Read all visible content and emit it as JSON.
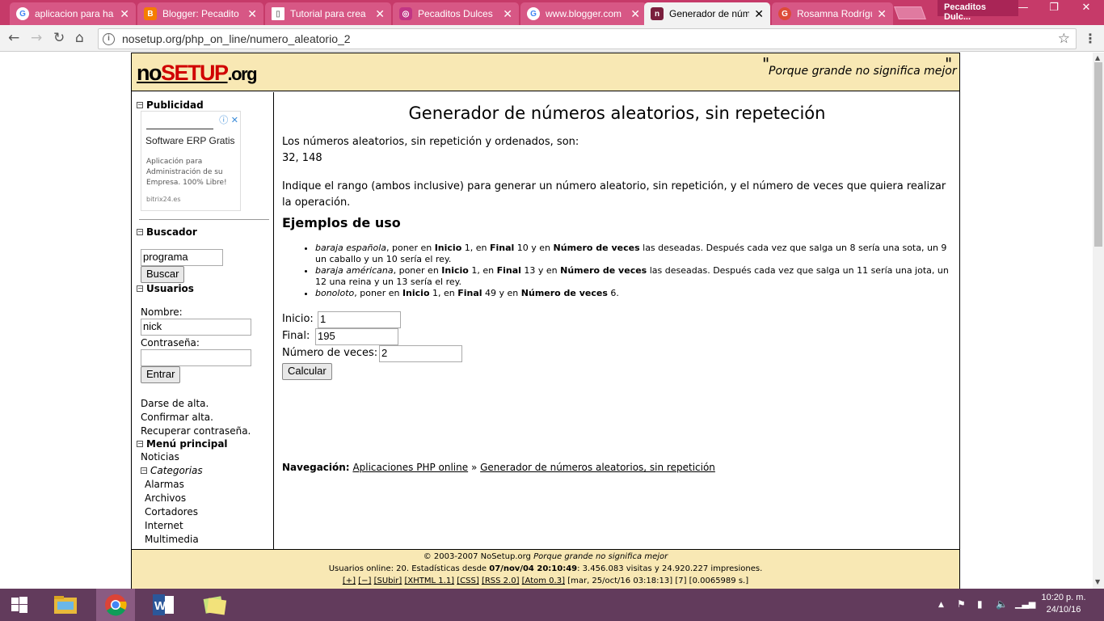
{
  "browser": {
    "tabs": [
      {
        "title": "aplicacion para ha",
        "icon": "google-icon"
      },
      {
        "title": "Blogger: Pecadito",
        "icon": "blogger-icon"
      },
      {
        "title": "Tutorial para crea",
        "icon": "page-icon"
      },
      {
        "title": "Pecaditos Dulces",
        "icon": "instagram-icon"
      },
      {
        "title": "www.blogger.com",
        "icon": "google-icon"
      },
      {
        "title": "Generador de núm",
        "icon": "nosetup-icon",
        "active": true
      },
      {
        "title": "Rosamna Rodrígu",
        "icon": "google-plus-icon"
      }
    ],
    "profile": "Pecaditos Dulc...",
    "url": "nosetup.org/php_on_line/numero_aleatorio_2",
    "accent": "#c63a69"
  },
  "header": {
    "logo_no": "no",
    "logo_setup": "SETUP",
    "logo_org": ".org",
    "slogan": "Porque grande no significa mejor"
  },
  "sidebar": {
    "publicidad": "Publicidad",
    "ad": {
      "title": "Software ERP Gratis",
      "desc": "Aplicación para Administración de su Empresa. 100% Libre!",
      "url": "bitrix24.es"
    },
    "buscador": "Buscador",
    "search_value": "programa",
    "search_button": "Buscar",
    "usuarios": "Usuarios",
    "nombre_label": "Nombre:",
    "nombre_value": "nick",
    "pass_label": "Contraseña:",
    "login_button": "Entrar",
    "links": [
      "Darse de alta.",
      "Confirmar alta.",
      "Recuperar contraseña."
    ],
    "menu_principal": "Menú principal",
    "noticias": "Noticias",
    "categorias": "Categorias",
    "categories": [
      "Alarmas",
      "Archivos",
      "Cortadores",
      "Internet",
      "Multimedia"
    ]
  },
  "content": {
    "title": "Generador de números aleatorios, sin repeteción",
    "result_label": "Los números aleatorios, sin repetición y ordenados, son:",
    "result_value": "32, 148",
    "instructions": "Indique el rango (ambos inclusive) para generar un número aleatorio, sin repetición, y el número de veces que quiera realizar la operación.",
    "examples_heading": "Ejemplos de uso",
    "examples": [
      {
        "em": "baraja española",
        "rest1": ", poner en ",
        "b1": "Inicio",
        "rest2": " 1, en ",
        "b2": "Final",
        "rest3": " 10 y en ",
        "b3": "Número de veces",
        "rest4": " las deseadas. Después cada vez que salga un 8 sería una sota, un 9 un caballo y un 10 sería el rey."
      },
      {
        "em": "baraja américana",
        "rest1": ", poner en ",
        "b1": "Inicio",
        "rest2": " 1, en ",
        "b2": "Final",
        "rest3": " 13 y en ",
        "b3": "Número de veces",
        "rest4": " las deseadas. Después cada vez que salga un 11 sería una jota, un 12 una reina y un 13 sería el rey."
      },
      {
        "em": "bonoloto",
        "rest1": ", poner en ",
        "b1": "Inicio",
        "rest2": " 1, en ",
        "b2": "Final",
        "rest3": " 49 y en ",
        "b3": "Número de veces",
        "rest4": " 6."
      }
    ],
    "inicio_label": "Inicio:",
    "inicio_value": "1",
    "final_label": "Final:",
    "final_value": "195",
    "veces_label": "Número de veces:",
    "veces_value": "2",
    "calc_button": "Calcular",
    "nav_label": "Navegación:",
    "nav_link1": "Aplicaciones PHP online",
    "nav_sep": "»",
    "nav_link2": "Generador de números aleatorios, sin repetición"
  },
  "footer": {
    "copyright": "© 2003-2007 NoSetup.org",
    "copyright_em": "Porque grande no significa mejor",
    "stats_pre": "Usuarios online: 20. Estadísticas desde ",
    "stats_date": "07/nov/04 20:10:49",
    "stats_post": ": 3.456.083 visitas y 24.920.227 impresiones.",
    "links": [
      "[+]",
      "[−]",
      "[SUbir]",
      "[XHTML 1.1]",
      "[CSS]",
      "[RSS 2.0]",
      "[Atom 0.3]"
    ],
    "tail": "[mar, 25/oct/16 03:18:13] [7] [0.0065989 s.]"
  },
  "taskbar": {
    "time": "10:20 p. m.",
    "date": "24/10/16"
  }
}
